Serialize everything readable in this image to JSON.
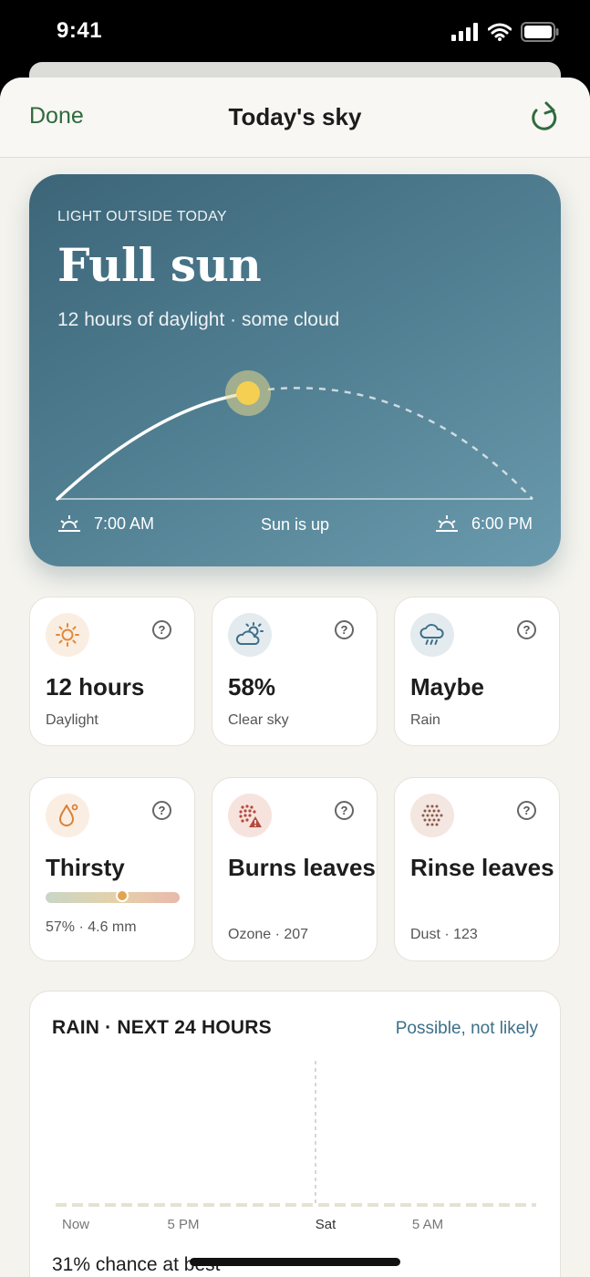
{
  "status_bar": {
    "time": "9:41"
  },
  "nav": {
    "done_label": "Done",
    "title": "Today's sky"
  },
  "hero": {
    "eyebrow": "LIGHT OUTSIDE TODAY",
    "title": "Full sun",
    "subtitle": "12 hours of daylight · some cloud",
    "sunrise": "7:00 AM",
    "status": "Sun is up",
    "sunset": "6:00 PM"
  },
  "tiles": [
    {
      "icon": "sun-icon",
      "value": "12 hours",
      "label": "Daylight"
    },
    {
      "icon": "partly-cloudy-icon",
      "value": "58%",
      "label": "Clear sky"
    },
    {
      "icon": "rain-cloud-icon",
      "value": "Maybe",
      "label": "Rain"
    },
    {
      "icon": "water-drop-icon",
      "value": "Thirsty",
      "label": "57% · 4.6 mm",
      "level": 0.57
    },
    {
      "icon": "ozone-warning-icon",
      "value": "Burns leaves",
      "label": "Ozone · 207"
    },
    {
      "icon": "dust-icon",
      "value": "Rinse leaves",
      "label": "Dust · 123"
    }
  ],
  "rain": {
    "title": "RAIN · NEXT 24 HOURS",
    "status": "Possible, not likely",
    "summary": "31% chance at best"
  },
  "chart_data": {
    "type": "bar",
    "categories": [
      "Now",
      "5 PM",
      "Sat",
      "5 AM"
    ],
    "values": [
      0,
      0,
      0,
      0
    ]
  },
  "colors": {
    "accent": "#2f6a3e",
    "hero_start": "#3c6578",
    "hero_end": "#6a9aad",
    "link": "#3d6f89"
  }
}
